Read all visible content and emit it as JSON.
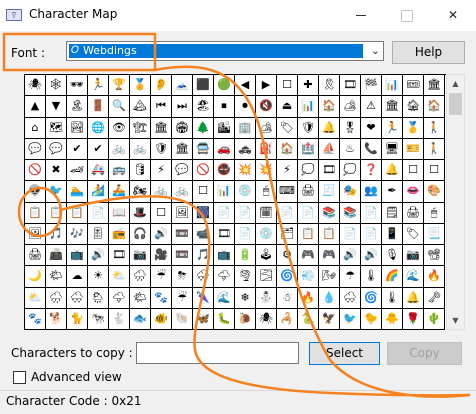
{
  "window": {
    "title": "Character Map",
    "app_icon": "charmap-app-icon",
    "controls": {
      "minimize": "minimize-icon",
      "maximize": "maximize-icon",
      "close": "✕"
    }
  },
  "font": {
    "label": "Font :",
    "selected": "Webdings",
    "glyph": "𝑂"
  },
  "help_button": "Help",
  "grid": {
    "columns": 20,
    "rows": 12,
    "cells": [
      "🕷",
      "🕸",
      "🕶",
      "🏃",
      "🏆",
      "🏅",
      "👂",
      "🗻",
      "⬛",
      "🟢",
      "◀",
      "▶",
      "☐",
      "✚",
      "🎗",
      "🎞",
      "🏁",
      "📊",
      "🎟",
      "🏛",
      "▲",
      "▼",
      "🏝",
      "🚪",
      "🔍",
      "🏔",
      "⏮",
      "⏭",
      "🏖",
      "⏹",
      "⏺",
      "🔇",
      "⏏",
      "📊",
      "🏠",
      "🏕",
      "⚠",
      "🏛",
      "🏚",
      "🏠",
      "⌂",
      "🗺",
      "🏞",
      "🌐",
      "👁",
      "🏗",
      "🏛",
      "🏟",
      "🌲",
      "🏙",
      "🏢",
      "🏕",
      "🏷",
      "🛡",
      "🔔",
      "🎖",
      "❤",
      "🏃",
      "🥇",
      "🚶",
      "💬",
      "💬",
      "✔",
      "✔",
      "🚲",
      "🚲",
      "🛡",
      "🏛",
      "🚍",
      "🚗",
      "🚓",
      "⛽",
      "🏠",
      "🏥",
      "⛵",
      "♨",
      "📞",
      "🖥",
      "🎫",
      "🚶",
      "🚫",
      "✖",
      "🏎",
      "🚑",
      "🚌",
      "🛢",
      "⚡",
      "💬",
      "🚫",
      "🚭",
      "💥",
      "💥",
      "⚡",
      "💭",
      "🎞",
      "💭",
      "❓",
      "🔔",
      "☐",
      "☐",
      "👽",
      "🐦",
      "🏊",
      "🏄",
      "🚣",
      "🏍",
      "🚲",
      "🚲",
      "☐",
      "📊",
      "💿",
      "🖱",
      "⌨",
      "🖨",
      "🧾",
      "🎭",
      "👥",
      "✒",
      "👄",
      "🎨",
      "📋",
      "📋",
      "📋",
      "📄",
      "📖",
      "🎩",
      "☐",
      "🖼",
      "🎆",
      "📄",
      "📄",
      "🗓",
      "📄",
      "📄",
      "📚",
      "📚",
      "📄",
      "🗒",
      "🖨",
      "🖱",
      "🖼",
      "🎵",
      "🎶",
      "🎚",
      "📻",
      "🎧",
      "🔊",
      "📼",
      "📹",
      "🎞",
      "📄",
      "💿",
      "🗂",
      "📋",
      "📋",
      "📄",
      "📄",
      "📱",
      "🏷",
      "📃",
      "🖨",
      "📠",
      "📺",
      "🔊",
      "🎞",
      "📷",
      "🎥",
      "📼",
      "🎵",
      "📺",
      "🔋",
      "🕹",
      "⚙",
      "🎮",
      "🎮",
      "🔊",
      "🔊",
      "🎙",
      "📷",
      "📽",
      "🌙",
      "🌤",
      "☁",
      "☀",
      "⛅",
      "🌧",
      "☔",
      "⛈",
      "🌨",
      "🌩",
      "🌪",
      "🌫",
      "🌀",
      "💨",
      "🌬",
      "☂",
      "🌡",
      "🌈",
      "🌊",
      "🔥",
      "⛅",
      "🌧",
      "🌨",
      "🌦",
      "🌩",
      "🌤",
      "🐾",
      "☔",
      "🌂",
      "🌊",
      "❄",
      "⛄",
      "☃",
      "🔥",
      "💧",
      "🌨",
      "🌀",
      "🌡",
      "🔔",
      "🗝",
      "🐾",
      "🐕",
      "🐈",
      "🐄",
      "🐇",
      "🐟",
      "🐠",
      "🐚",
      "🦋",
      "🐛",
      "🐌",
      "🕷",
      "🦂",
      "🐍",
      "🦅",
      "🐦",
      "🐤",
      "🐥",
      "🌹",
      "🌵"
    ]
  },
  "scrollbar": {
    "up_icon": "▲",
    "down_icon": "▼"
  },
  "characters_to_copy": {
    "label": "Characters to copy :",
    "value": ""
  },
  "select_button": "Select",
  "copy_button": "Copy",
  "advanced_view": {
    "label": "Advanced view",
    "checked": false
  },
  "status": "Character Code : 0x21",
  "colors": {
    "annotation": "#f5821f",
    "selection": "#0078d7"
  }
}
